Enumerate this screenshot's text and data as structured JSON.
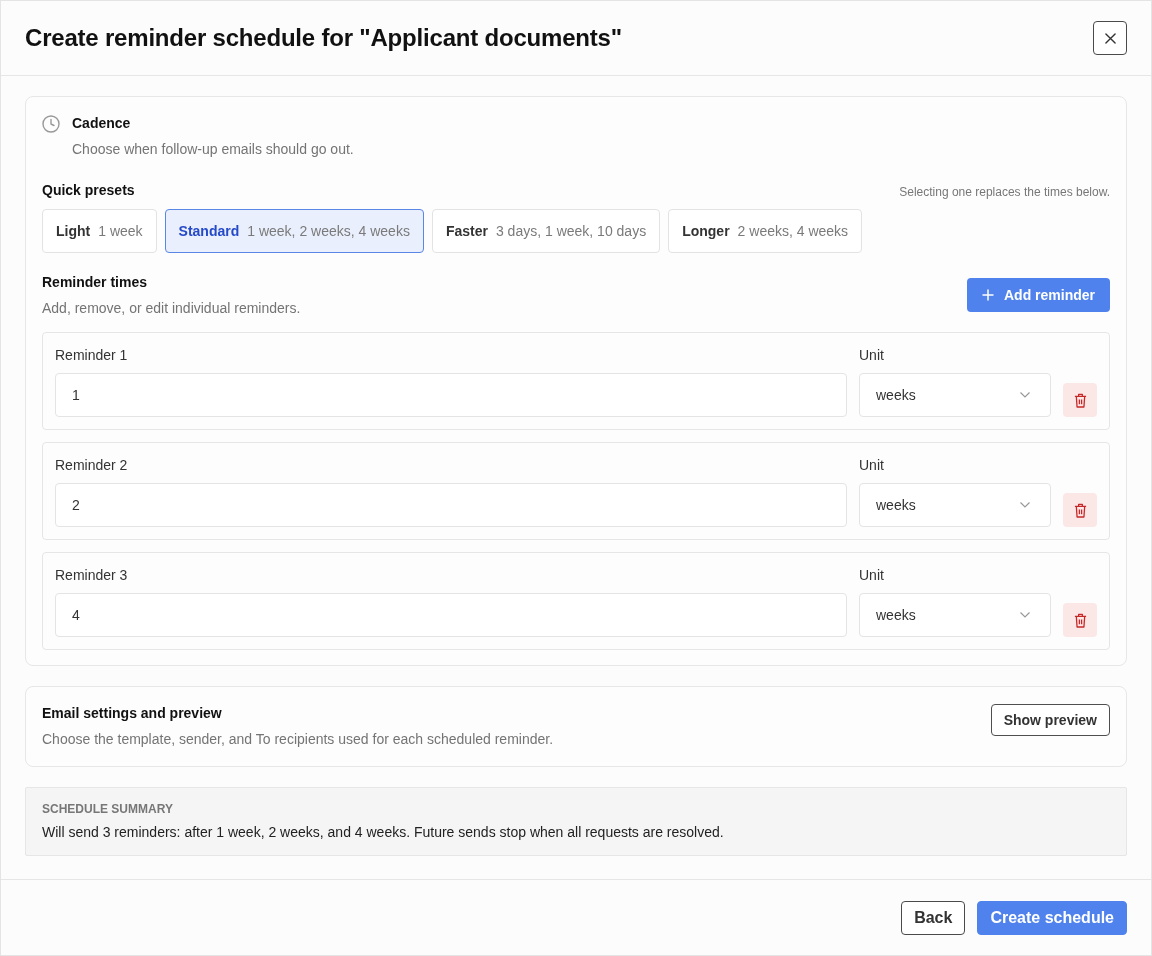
{
  "dialog": {
    "title": "Create reminder schedule for \"Applicant documents\""
  },
  "cadence": {
    "title": "Cadence",
    "description": "Choose when follow-up emails should go out."
  },
  "quick_presets": {
    "label": "Quick presets",
    "hint": "Selecting one replaces the times below.",
    "presets": [
      {
        "name": "Light",
        "detail": "1 week",
        "selected": false
      },
      {
        "name": "Standard",
        "detail": "1 week, 2 weeks, 4 weeks",
        "selected": true
      },
      {
        "name": "Faster",
        "detail": "3 days, 1 week, 10 days",
        "selected": false
      },
      {
        "name": "Longer",
        "detail": "2 weeks, 4 weeks",
        "selected": false
      }
    ]
  },
  "reminder_times": {
    "label": "Reminder times",
    "description": "Add, remove, or edit individual reminders.",
    "add_button": "Add reminder",
    "reminders": [
      {
        "label": "Reminder 1",
        "value": "1",
        "unit_label": "Unit",
        "unit": "weeks"
      },
      {
        "label": "Reminder 2",
        "value": "2",
        "unit_label": "Unit",
        "unit": "weeks"
      },
      {
        "label": "Reminder 3",
        "value": "4",
        "unit_label": "Unit",
        "unit": "weeks"
      }
    ]
  },
  "email_settings": {
    "title": "Email settings and preview",
    "description": "Choose the template, sender, and To recipients used for each scheduled reminder.",
    "button": "Show preview"
  },
  "summary": {
    "heading": "SCHEDULE SUMMARY",
    "text": "Will send 3 reminders: after 1 week, 2 weeks, and 4 weeks. Future sends stop when all requests are resolved."
  },
  "footer": {
    "buttons": [
      {
        "label": "Back",
        "kind": "secondary"
      },
      {
        "label": "Create schedule",
        "kind": "primary"
      }
    ]
  }
}
